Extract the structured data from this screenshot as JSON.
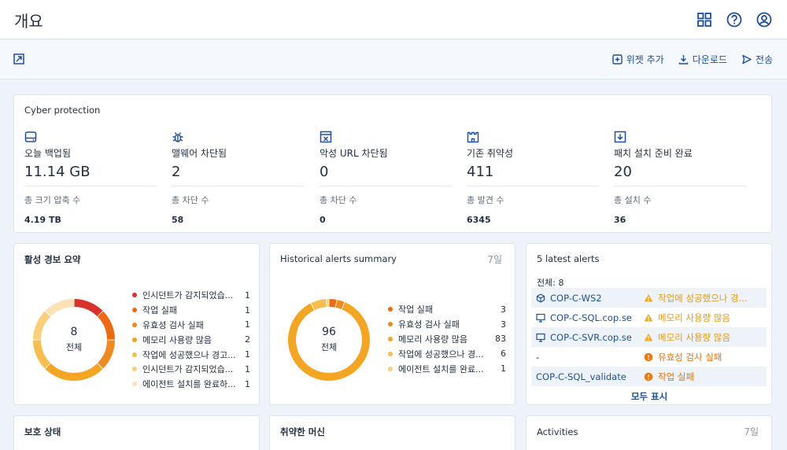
{
  "header": {
    "title": "개요",
    "icons": [
      "grid-icon",
      "help-icon",
      "user-icon"
    ]
  },
  "toolbar": {
    "add_widget": "위젯 추가",
    "download": "다운로드",
    "send": "전송"
  },
  "cyber": {
    "title": "Cyber protection",
    "stats": [
      {
        "icon": "backup-drive-icon",
        "label": "오늘 백업됨",
        "value": "11.14 GB",
        "sub_label": "총 크기 압축 수",
        "sub_value": "4.19 TB"
      },
      {
        "icon": "bug-icon",
        "label": "맬웨어 차단됨",
        "value": "2",
        "sub_label": "총 차단 수",
        "sub_value": "58"
      },
      {
        "icon": "blocked-url-icon",
        "label": "악성 URL 차단됨",
        "value": "0",
        "sub_label": "총 차단 수",
        "sub_value": "0"
      },
      {
        "icon": "castle-icon",
        "label": "기존 취약성",
        "value": "411",
        "sub_label": "총 발견 수",
        "sub_value": "6345"
      },
      {
        "icon": "patch-download-icon",
        "label": "패치 설치 준비 완료",
        "value": "20",
        "sub_label": "총 설치 수",
        "sub_value": "36"
      }
    ]
  },
  "active_alerts": {
    "title": "활성 경보 요약",
    "total": "8",
    "total_label": "전체",
    "items": [
      {
        "label": "인시던트가 감지되었습...",
        "count": "1",
        "color": "#d9342b"
      },
      {
        "label": "작업 실패",
        "count": "1",
        "color": "#ee6a12"
      },
      {
        "label": "유효성 검사 실패",
        "count": "1",
        "color": "#f08a1e"
      },
      {
        "label": "메모리 사용량 많음",
        "count": "2",
        "color": "#f5a524"
      },
      {
        "label": "작업에 성공했으나 경고...",
        "count": "1",
        "color": "#f7bd4f"
      },
      {
        "label": "인시던트가 감지되었습...",
        "count": "1",
        "color": "#fbcf7a"
      },
      {
        "label": "에이전트 설치를 완료하...",
        "count": "1",
        "color": "#fde1b4"
      }
    ]
  },
  "historical": {
    "title": "Historical alerts summary",
    "period": "7일",
    "total": "96",
    "total_label": "전체",
    "items": [
      {
        "label": "작업 실패",
        "count": "3",
        "color": "#ee6a12"
      },
      {
        "label": "유효성 검사 실패",
        "count": "3",
        "color": "#f08a1e"
      },
      {
        "label": "메모리 사용량 많음",
        "count": "83",
        "color": "#f5a524"
      },
      {
        "label": "작업에 성공했으나 경...",
        "count": "6",
        "color": "#f7bd4f"
      },
      {
        "label": "에이전트 설치를 완료...",
        "count": "1",
        "color": "#fbcf7a"
      }
    ]
  },
  "latest": {
    "title": "5 latest alerts",
    "total": "전체: 8",
    "rows": [
      {
        "name": "COP-C-WS2",
        "icon": "cube-icon",
        "message": "작업에 성공했으나 경...",
        "level": "warn"
      },
      {
        "name": "COP-C-SQL.cop.se",
        "icon": "monitor-icon",
        "message": "메모리 사용량 많음",
        "level": "warn"
      },
      {
        "name": "COP-C-SVR.cop.se",
        "icon": "monitor-icon",
        "message": "메모리 사용량 많음",
        "level": "warn"
      },
      {
        "name": "-",
        "icon": "",
        "message": "유효성 검사 실패",
        "level": "err"
      },
      {
        "name": "COP-C-SQL_validate",
        "icon": "",
        "message": "작업 실패",
        "level": "err"
      }
    ],
    "show_all": "모두 표시"
  },
  "protection": {
    "title": "보호 상태"
  },
  "vulnerable": {
    "title": "취약한 머신"
  },
  "activities": {
    "title": "Activities",
    "period": "7일",
    "tick": "360"
  }
}
